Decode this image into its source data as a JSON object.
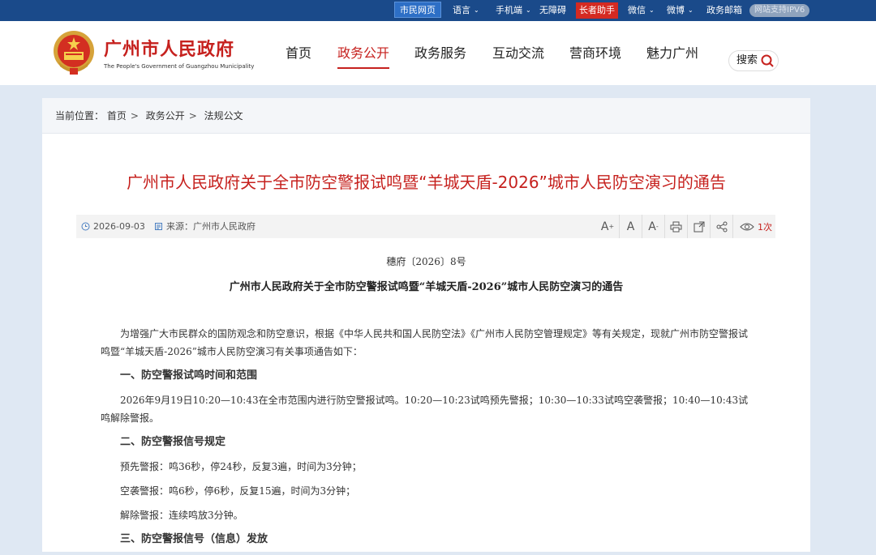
{
  "topbar": {
    "citizen": "市民网页",
    "language": "语言",
    "mobile": "手机端",
    "accessibility": "无障碍",
    "elder": "长者助手",
    "wechat": "微信",
    "weibo": "微博",
    "mail": "政务邮箱",
    "ipv6": "网站支持IPV6"
  },
  "header": {
    "title": "广州市人民政府",
    "subtitle": "The People's Government of Guangzhou Municipality",
    "nav": [
      "首页",
      "政务公开",
      "政务服务",
      "互动交流",
      "营商环境",
      "魅力广州"
    ],
    "search": "搜索"
  },
  "breadcrumb": {
    "prefix": "当前位置：",
    "items": [
      "首页",
      "政务公开",
      "法规公文"
    ]
  },
  "article": {
    "title": "广州市人民政府关于全市防空警报试鸣暨“羊城天盾-2026”城市人民防空演习的通告",
    "date": "2026-09-03",
    "source": "来源：广州市人民政府",
    "views": "1次",
    "doc_no": "穗府〔2026〕8号",
    "subtitle": "广州市人民政府关于全市防空警报试鸣暨“羊城天盾-2026”城市人民防空演习的通告",
    "paragraphs": [
      "为增强广大市民群众的国防观念和防空意识，根据《中华人民共和国人民防空法》《广州市人民防空管理规定》等有关规定，现就广州市防空警报试鸣暨“羊城天盾-2026”城市人民防空演习有关事项通告如下：",
      "一、防空警报试鸣时间和范围",
      "2026年9月19日10:20—10:43在全市范围内进行防空警报试鸣。10:20—10:23试鸣预先警报；10:30—10:33试鸣空袭警报；10:40—10:43试鸣解除警报。",
      "二、防空警报信号规定",
      "预先警报：鸣36秒，停24秒，反复3遍，时间为3分钟；",
      "空袭警报：鸣6秒，停6秒，反复15遍，时间为3分钟；",
      "解除警报：连续鸣放3分钟。",
      "三、防空警报信号（信息）发放"
    ]
  }
}
